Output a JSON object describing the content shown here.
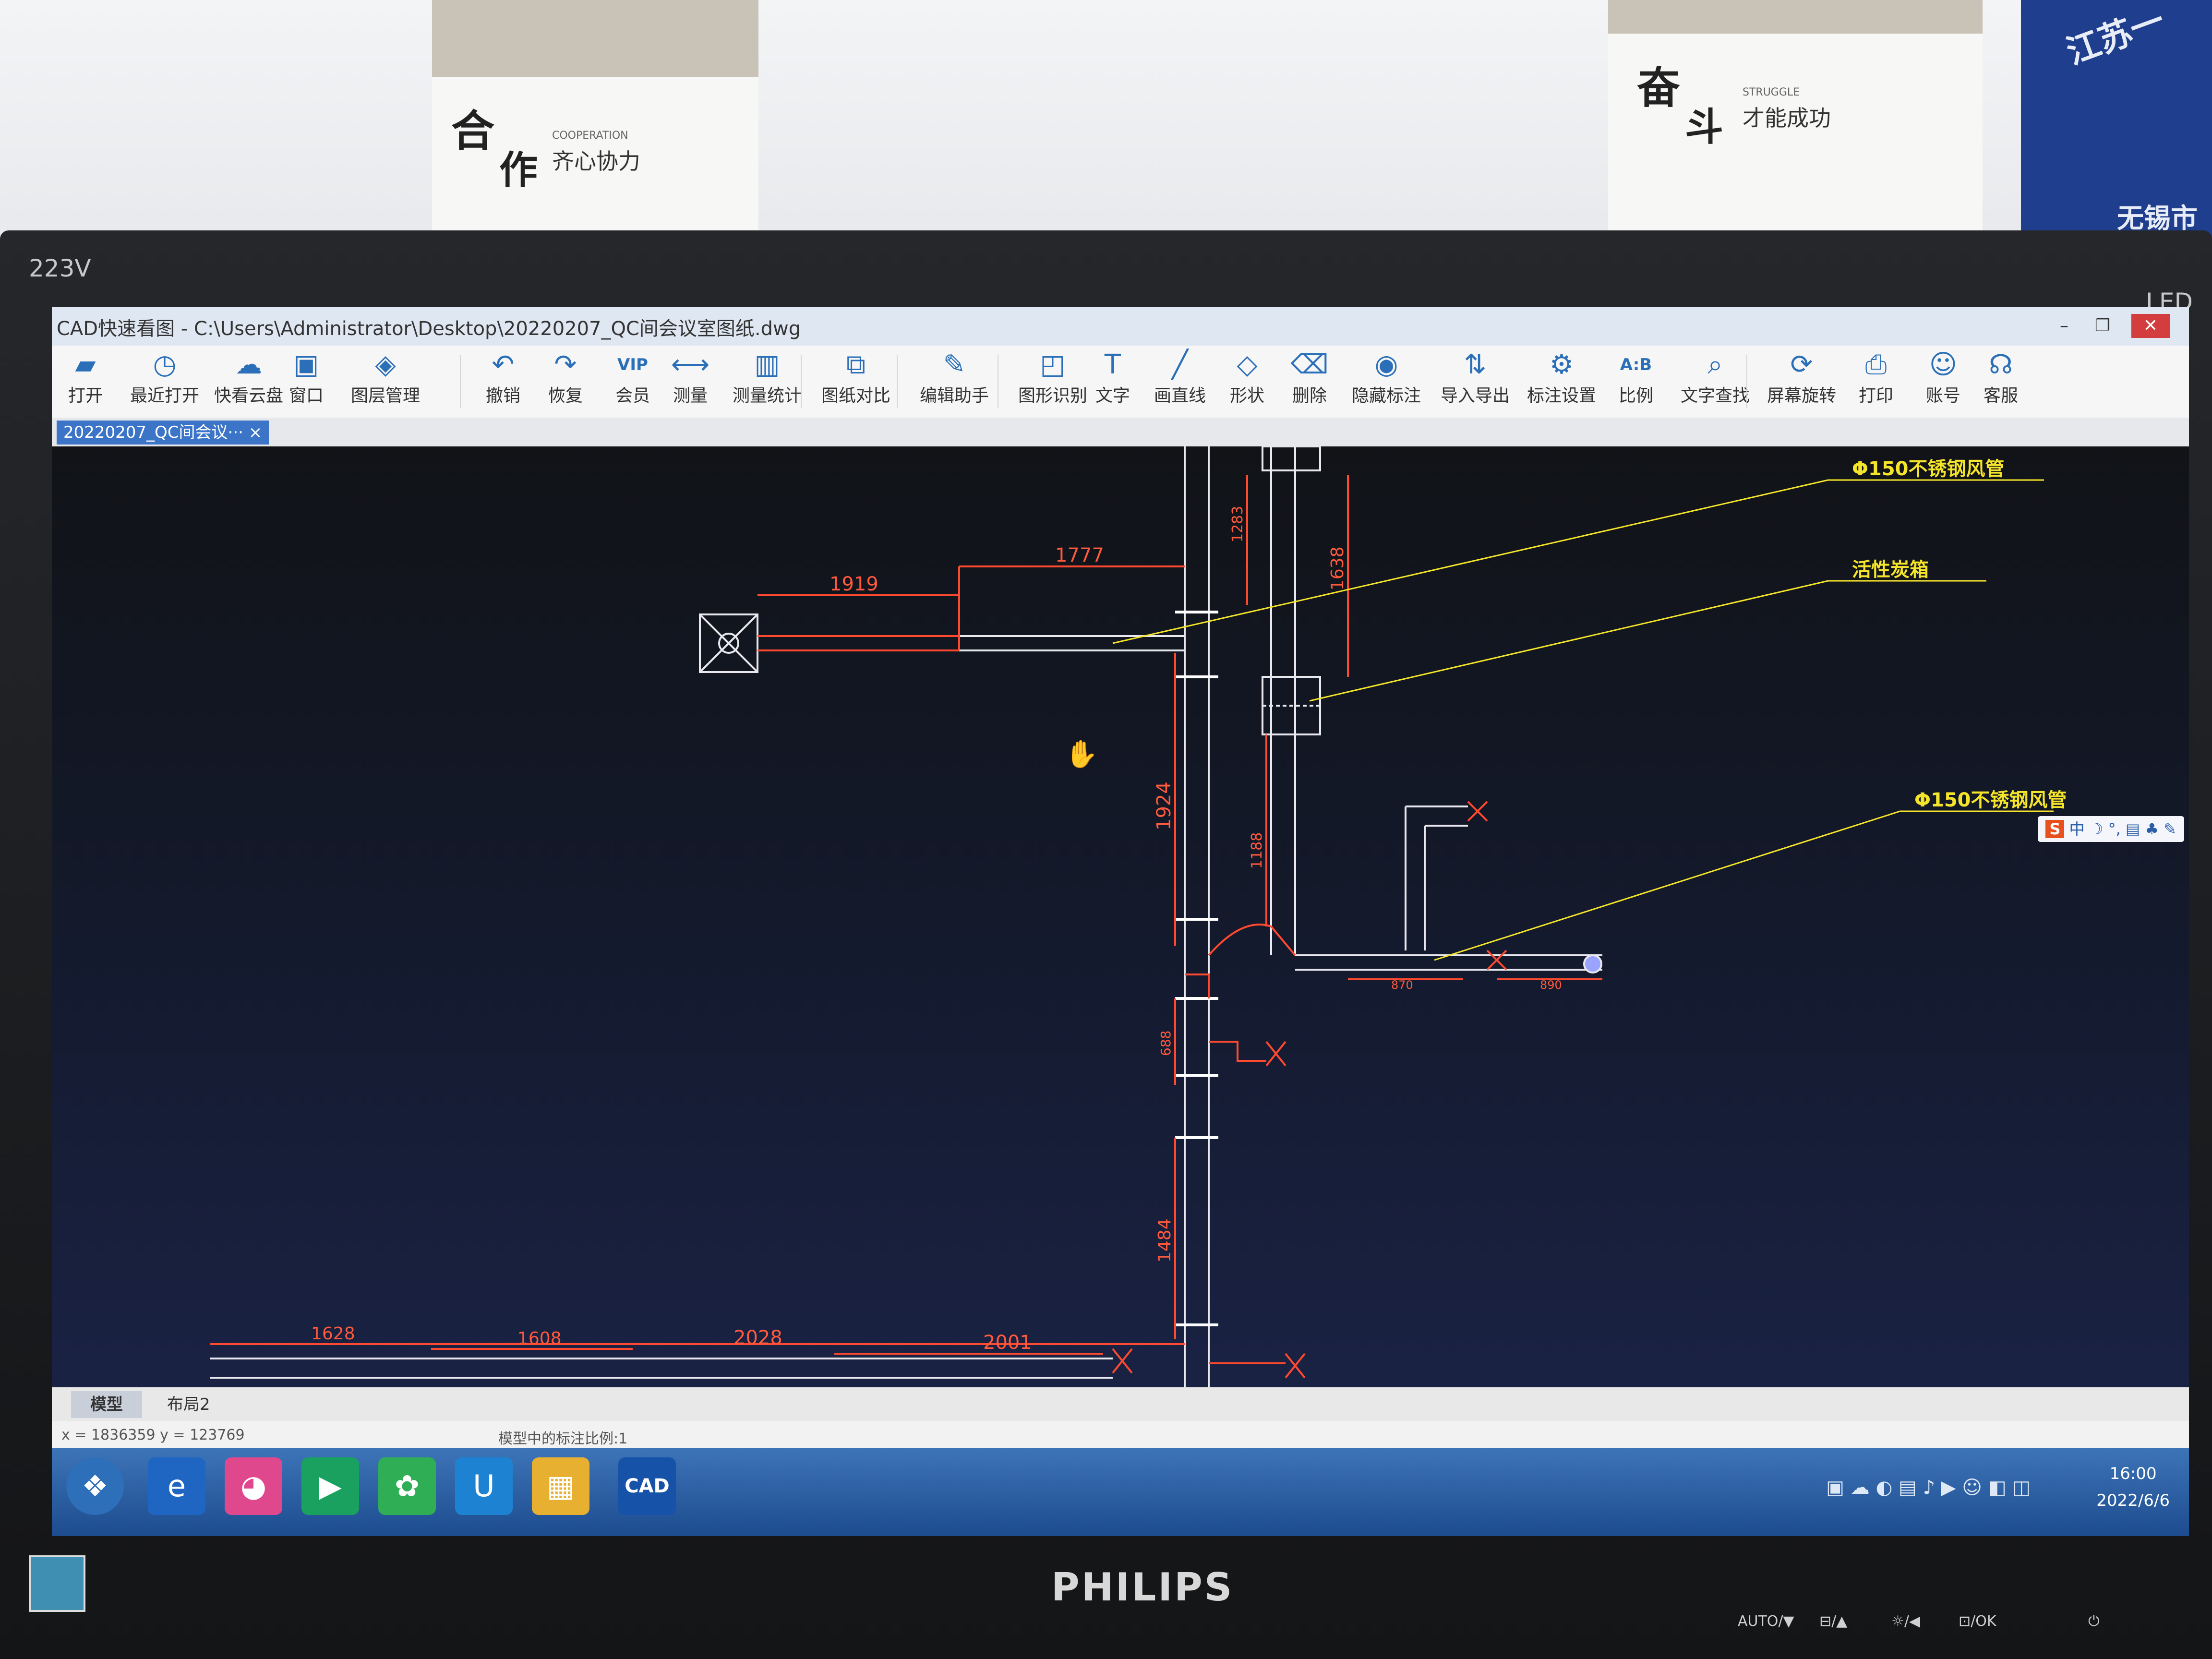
{
  "posters": {
    "left": {
      "char1": "合",
      "char2": "作",
      "slogan": "齐心协力",
      "en": "COOPERATION"
    },
    "right": {
      "char1": "奋",
      "char2": "斗",
      "slogan": "才能成功",
      "en": "STRUGGLE"
    },
    "blue": {
      "line1": "江苏一",
      "line2": "无锡市"
    }
  },
  "monitor": {
    "model": "223V",
    "led": "LED",
    "brand": "PHILIPS",
    "buttons": [
      "AUTO/▼",
      "⊟/▲",
      "☼/◀",
      "⊡/OK",
      "⏻"
    ]
  },
  "window": {
    "title": "CAD快速看图 - C:\\Users\\Administrator\\Desktop\\20220207_QC间会议室图纸.dwg",
    "doc_tab": "20220207_QC间会议··· ×"
  },
  "toolbar": [
    {
      "label": "打开",
      "icon": "open-folder-icon",
      "glyph": "▰"
    },
    {
      "label": "最近打开",
      "icon": "clock-icon",
      "glyph": "◷"
    },
    {
      "label": "快看云盘",
      "icon": "cloud-icon",
      "glyph": "☁"
    },
    {
      "label": "窗口",
      "icon": "window-icon",
      "glyph": "▣"
    },
    {
      "label": "图层管理",
      "icon": "layers-icon",
      "glyph": "◈"
    },
    {
      "label": "撤销",
      "icon": "undo-icon",
      "glyph": "↶"
    },
    {
      "label": "恢复",
      "icon": "redo-icon",
      "glyph": "↷"
    },
    {
      "label": "会员",
      "icon": "vip-icon",
      "glyph": "VIP"
    },
    {
      "label": "测量",
      "icon": "measure-icon",
      "glyph": "⟷"
    },
    {
      "label": "测量统计",
      "icon": "measure-stats-icon",
      "glyph": "▥"
    },
    {
      "label": "图纸对比",
      "icon": "compare-icon",
      "glyph": "⧉"
    },
    {
      "label": "编辑助手",
      "icon": "edit-assistant-icon",
      "glyph": "✎"
    },
    {
      "label": "图形识别",
      "icon": "shape-recognition-icon",
      "glyph": "◰"
    },
    {
      "label": "文字",
      "icon": "text-icon",
      "glyph": "T"
    },
    {
      "label": "画直线",
      "icon": "line-icon",
      "glyph": "╱"
    },
    {
      "label": "形状",
      "icon": "shape-icon",
      "glyph": "◇"
    },
    {
      "label": "删除",
      "icon": "eraser-icon",
      "glyph": "⌫"
    },
    {
      "label": "隐藏标注",
      "icon": "hide-eye-icon",
      "glyph": "◉"
    },
    {
      "label": "导入导出",
      "icon": "import-export-icon",
      "glyph": "⇅"
    },
    {
      "label": "标注设置",
      "icon": "annotation-settings-icon",
      "glyph": "⚙"
    },
    {
      "label": "比例",
      "icon": "scale-icon",
      "glyph": "A:B"
    },
    {
      "label": "文字查找",
      "icon": "text-search-icon",
      "glyph": "⌕"
    },
    {
      "label": "屏幕旋转",
      "icon": "rotate-icon",
      "glyph": "⟳"
    },
    {
      "label": "打印",
      "icon": "printer-icon",
      "glyph": "⎙"
    },
    {
      "label": "账号",
      "icon": "account-icon",
      "glyph": "☺"
    },
    {
      "label": "客服",
      "icon": "headset-icon",
      "glyph": "☊"
    }
  ],
  "drawing": {
    "dims": {
      "d1919": "1919",
      "d1777": "1777",
      "d1283": "1283",
      "d1638": "1638",
      "d1924": "1924",
      "d1188": "1188",
      "d870": "870",
      "d890": "890",
      "d688": "688",
      "d1484": "1484",
      "d1628": "1628",
      "d1608": "1608",
      "d2028": "2028",
      "d2001": "2001"
    },
    "callouts": {
      "c1": "Φ150不锈钢风管",
      "c2": "活性炭箱",
      "c3": "Φ150不锈钢风管"
    }
  },
  "ime": "中 ☽ °, ▤ ♣ ✎",
  "layout_tabs": [
    "模型",
    "布局2"
  ],
  "status": {
    "coords": "x = 1836359  y = 123769",
    "scale": "模型中的标注比例:1"
  },
  "taskbar": {
    "time": "16:00",
    "date": "2022/6/6",
    "apps": [
      {
        "glyph": "❖",
        "color": "#2d6fb8",
        "name": "start"
      },
      {
        "glyph": "e",
        "color": "#1f66c2",
        "name": "ie"
      },
      {
        "glyph": "◕",
        "color": "#e0488e",
        "name": "chat"
      },
      {
        "glyph": "▶",
        "color": "#1aa160",
        "name": "player"
      },
      {
        "glyph": "✿",
        "color": "#2fae55",
        "name": "wechat"
      },
      {
        "glyph": "U",
        "color": "#1e82d2",
        "name": "tool"
      },
      {
        "glyph": "▦",
        "color": "#e8b030",
        "name": "office"
      },
      {
        "glyph": "CAD",
        "color": "#1552a8",
        "name": "cad"
      }
    ]
  }
}
